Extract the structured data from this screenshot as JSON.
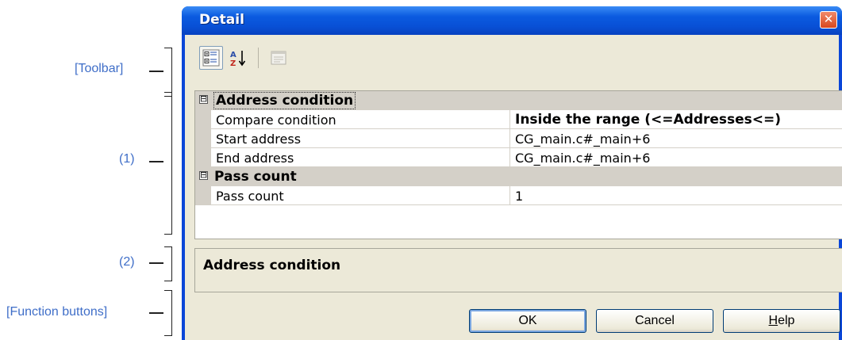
{
  "callouts": {
    "toolbar": "[Toolbar]",
    "grid": "(1)",
    "description": "(2)",
    "function_buttons": "[Function buttons]"
  },
  "window": {
    "title": "Detail",
    "close_glyph": "✕"
  },
  "toolbar": {
    "buttons": [
      {
        "icon": "categorized-view-icon",
        "active": true
      },
      {
        "icon": "alphabetical-sort-icon",
        "label": "AZ"
      },
      {
        "icon": "property-pages-icon",
        "enabled": false
      }
    ]
  },
  "grid": {
    "categories": [
      {
        "label": "Address condition",
        "expander": "⊟",
        "properties": [
          {
            "name": "Compare condition",
            "value": "Inside the range (<=Addresses<=)"
          },
          {
            "name": "Start address",
            "value": "CG_main.c#_main+6"
          },
          {
            "name": "End address",
            "value": "CG_main.c#_main+6"
          }
        ]
      },
      {
        "label": "Pass count",
        "expander": "⊟",
        "properties": [
          {
            "name": "Pass count",
            "value": "1"
          }
        ]
      }
    ]
  },
  "description": {
    "text": "Address condition"
  },
  "buttons": {
    "ok": "OK",
    "cancel": "Cancel",
    "help_mnemonic": "H",
    "help_rest": "elp"
  },
  "colors": {
    "titlebar": "#0b5be0",
    "callout_text": "#3f6ec8",
    "client_bg": "#ece9d8",
    "category_bg": "#d4d0c8"
  }
}
